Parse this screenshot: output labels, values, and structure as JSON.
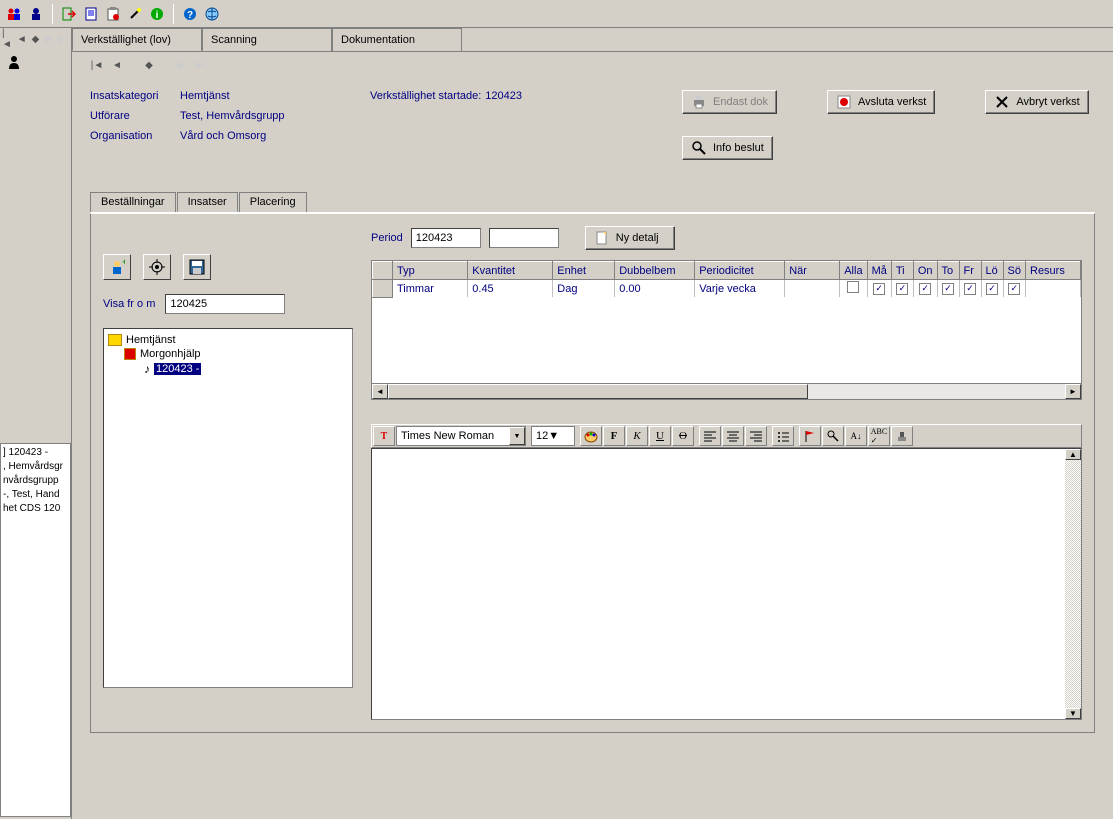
{
  "toolbar_icons": [
    "people-icon",
    "person-icon",
    "exit-icon",
    "page-icon",
    "clipboard-icon",
    "wand-icon",
    "info-icon",
    "help-icon",
    "world-icon"
  ],
  "main_tabs": [
    {
      "label": "Verkställighet (lov)",
      "active": true
    },
    {
      "label": "Scanning",
      "active": false
    },
    {
      "label": "Dokumentation",
      "active": false
    }
  ],
  "info": {
    "insatskategori_label": "Insatskategori",
    "insatskategori_value": "Hemtjänst",
    "utforare_label": "Utförare",
    "utforare_value": "Test, Hemvårdsgrupp",
    "organisation_label": "Organisation",
    "organisation_value": "Vård och Omsorg",
    "verkstallighet_label": "Verkställighet startade:",
    "verkstallighet_value": "120423"
  },
  "buttons": {
    "endast_dok": "Endast dok",
    "avsluta": "Avsluta verkst",
    "avbryt": "Avbryt verkst",
    "info_beslut": "Info beslut",
    "ny_detalj": "Ny detalj"
  },
  "sub_tabs": [
    {
      "label": "Beställningar",
      "active": false
    },
    {
      "label": "Insatser",
      "active": true
    },
    {
      "label": "Placering",
      "active": false
    }
  ],
  "period_label": "Period",
  "period_value": "120423",
  "visa_label": "Visa fr o m",
  "visa_value": "120425",
  "tree": {
    "root": "Hemtjänst",
    "child": "Morgonhjälp",
    "leaf": "120423 -"
  },
  "grid": {
    "headers": [
      "Typ",
      "Kvantitet",
      "Enhet",
      "Dubbelbem",
      "Periodicitet",
      "När",
      "Alla",
      "Må",
      "Ti",
      "On",
      "To",
      "Fr",
      "Lö",
      "Sö",
      "Resurs"
    ],
    "row": {
      "typ": "Timmar",
      "kvantitet": "0.45",
      "enhet": "Dag",
      "dubbelbem": "0.00",
      "periodicitet": "Varje vecka",
      "nar": "",
      "alla": false,
      "ma": true,
      "ti": true,
      "on": true,
      "to": true,
      "fr": true,
      "lo": true,
      "so": true,
      "resurs": ""
    }
  },
  "editor": {
    "font": "Times New Roman",
    "size": "12"
  },
  "left_list": [
    "] 120423 -",
    ", Hemvårdsgr",
    "nvårdsgrupp",
    "-, Test, Hand",
    "het CDS 120"
  ]
}
